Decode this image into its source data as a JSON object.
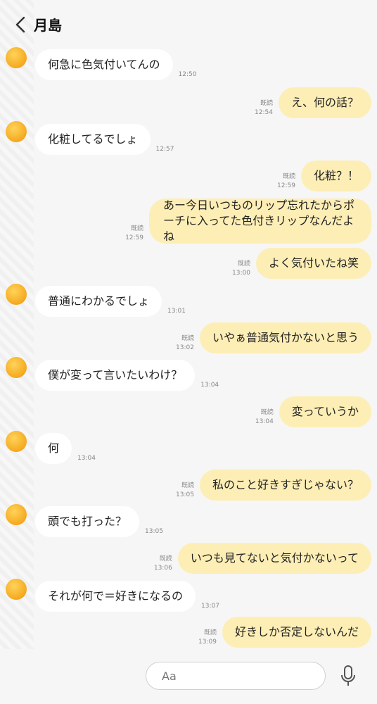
{
  "header": {
    "title": "月島"
  },
  "input": {
    "placeholder": "Aa"
  },
  "messages": [
    {
      "side": "in",
      "text": "何急に色気付いてんの",
      "time": "12:50"
    },
    {
      "side": "out",
      "text": "え、何の話？",
      "read": "既読",
      "time": "12:54"
    },
    {
      "side": "in",
      "text": "化粧してるでしょ",
      "time": "12:57"
    },
    {
      "side": "out",
      "text": "化粧？！",
      "read": "既読",
      "time": "12:59"
    },
    {
      "side": "out",
      "text": "あー今日いつものリップ忘れたからポーチに入ってた色付きリップなんだよね",
      "read": "既読",
      "time": "12:59"
    },
    {
      "side": "out",
      "text": "よく気付いたね笑",
      "read": "既読",
      "time": "13:00"
    },
    {
      "side": "in",
      "text": "普通にわかるでしょ",
      "time": "13:01"
    },
    {
      "side": "out",
      "text": "いやぁ普通気付かないと思う",
      "read": "既読",
      "time": "13:02"
    },
    {
      "side": "in",
      "text": "僕が変って言いたいわけ？",
      "time": "13:04"
    },
    {
      "side": "out",
      "text": "変っていうか",
      "read": "既読",
      "time": "13:04"
    },
    {
      "side": "in",
      "text": "何",
      "time": "13:04"
    },
    {
      "side": "out",
      "text": "私のこと好きすぎじゃない？",
      "read": "既読",
      "time": "13:05"
    },
    {
      "side": "in",
      "text": "頭でも打った？",
      "time": "13:05"
    },
    {
      "side": "out",
      "text": "いつも見てないと気付かないって",
      "read": "既読",
      "time": "13:06"
    },
    {
      "side": "in",
      "text": "それが何で＝好きになるの",
      "time": "13:07"
    },
    {
      "side": "out",
      "text": "好きしか否定しないんだ",
      "read": "既読",
      "time": "13:09"
    }
  ]
}
